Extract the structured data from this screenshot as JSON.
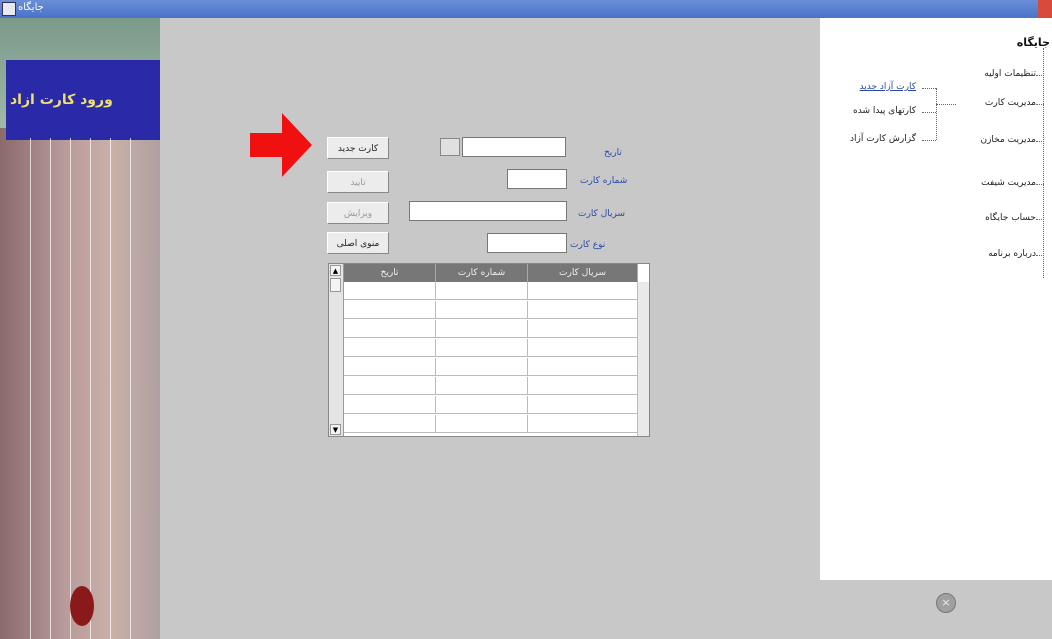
{
  "window": {
    "title": "جایگاه"
  },
  "left_banner": {
    "text": "ورود کارت ازاد"
  },
  "buttons": {
    "new_card": "کارت جدید",
    "confirm": "تایید",
    "edit": "ویرایش",
    "main_menu": "منوی اصلی"
  },
  "form": {
    "date_label": "تاریخ",
    "card_number_label": "شماره کارت",
    "card_serial_label": "سریال کارت",
    "card_type_label": "نوع کارت",
    "date_value": "",
    "card_number_value": "",
    "card_serial_value": "",
    "card_type_value": ""
  },
  "grid": {
    "columns": [
      "سریال کارت",
      "شماره کارت",
      "تاریخ"
    ],
    "row_count": 8
  },
  "nav": {
    "title": "جایگاه",
    "items": [
      "تنظیمات اولیه",
      "مدیریت کارت",
      "مدیریت مخازن",
      "مدیریت شیفت",
      "حساب جایگاه",
      "درباره برنامه"
    ],
    "subitems": [
      "کارت آزاد جدید",
      "کارتهای پیدا شده",
      "گزارش کارت آزاد"
    ]
  }
}
